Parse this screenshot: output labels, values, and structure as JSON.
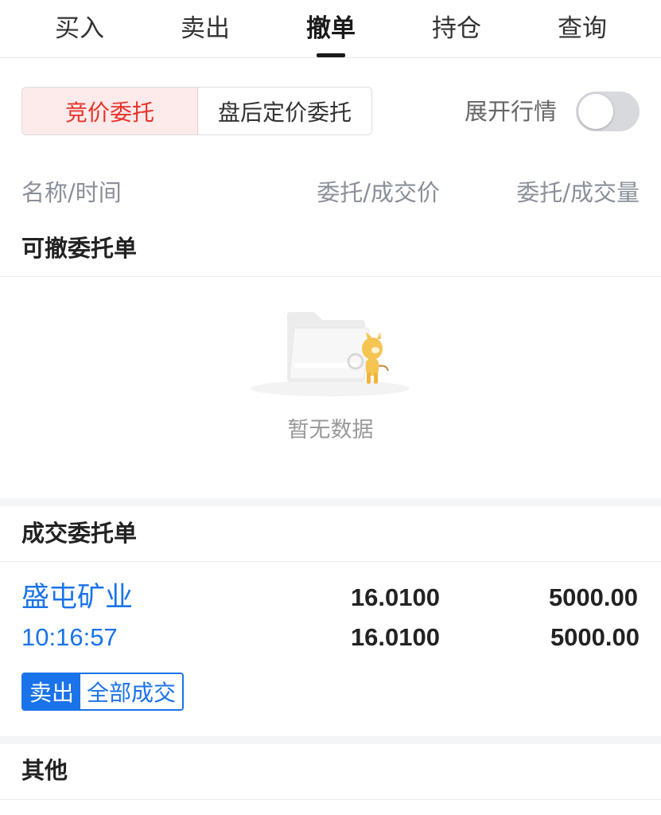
{
  "tabs": [
    {
      "label": "买入"
    },
    {
      "label": "卖出"
    },
    {
      "label": "撤单"
    },
    {
      "label": "持仓"
    },
    {
      "label": "查询"
    }
  ],
  "segment": {
    "items": [
      "竞价委托",
      "盘后定价委托"
    ],
    "active_index": 0
  },
  "expand_quote": {
    "label": "展开行情",
    "on": false
  },
  "columns": {
    "name_time": "名称/时间",
    "price": "委托/成交价",
    "volume": "委托/成交量"
  },
  "cancellable": {
    "title": "可撤委托单",
    "empty_text": "暂无数据"
  },
  "filled": {
    "title": "成交委托单",
    "orders": [
      {
        "name": "盛屯矿业",
        "time": "10:16:57",
        "order_price": "16.0100",
        "deal_price": "16.0100",
        "order_volume": "5000.00",
        "deal_volume": "5000.00",
        "side": "卖出",
        "status": "全部成交"
      }
    ]
  },
  "other": {
    "title": "其他"
  },
  "colors": {
    "accent_red": "#e8322b",
    "accent_blue": "#1a73e8"
  }
}
